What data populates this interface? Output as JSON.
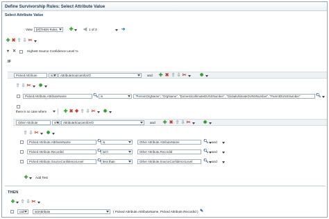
{
  "window": {
    "title": "Define Survivorship Rules: Select Attribute Value",
    "subtitle": "Select Attribute Value"
  },
  "toolbar": {
    "view_label": "View",
    "view_value": "[IF]THEN Rules",
    "pager": "1 of 3"
  },
  "rule": {
    "name": "Highest Source Confidence Level %"
  },
  "if_label": "IF",
  "then_label": "THEN",
  "if_row": {
    "attribute": "Picked Attribute",
    "operator": "is a",
    "value": "AttributeSourceInfoVO",
    "connector": "and"
  },
  "condition_1": {
    "left": "Picked Attribute.AttributeName",
    "operator": "is",
    "right": "\"PersonOrgName\", \"OrgName\", \"DomesticUltimateDUNSNumber\", \"GlobalUltimateDUNSNumber\", \"ParentDUNSNumber\""
  },
  "exists_label": "there is no case where",
  "exists_row": {
    "attribute": "Other Attribute",
    "operator": "is a",
    "value": "AttributeSourceInfoVO",
    "connector": "and"
  },
  "conditions": [
    {
      "left": "Picked Attribute.AttributeName",
      "operator": "is",
      "right": "Other Attribute.AttributeName",
      "connector": "and"
    },
    {
      "left": "Picked Attribute.RecordId",
      "operator": "isn't",
      "right": "Other Attribute.RecordId",
      "connector": "and"
    },
    {
      "left": "Picked Attribute.SourceConfidenceLevel",
      "operator": "less than",
      "right": "Other Attribute.SourceConfidenceLevel",
      "connector": "and"
    }
  ],
  "add_test_label": "Add Test",
  "then_row": {
    "action": "call",
    "function": "setAttribute",
    "args": "( Picked Attribute.AttributeName, Picked Attribute.RecordId )"
  },
  "colors": {
    "title": "#1f3b57",
    "add": "#2e9b2e",
    "delete": "#d03a2c",
    "band": "#eef2f5"
  }
}
